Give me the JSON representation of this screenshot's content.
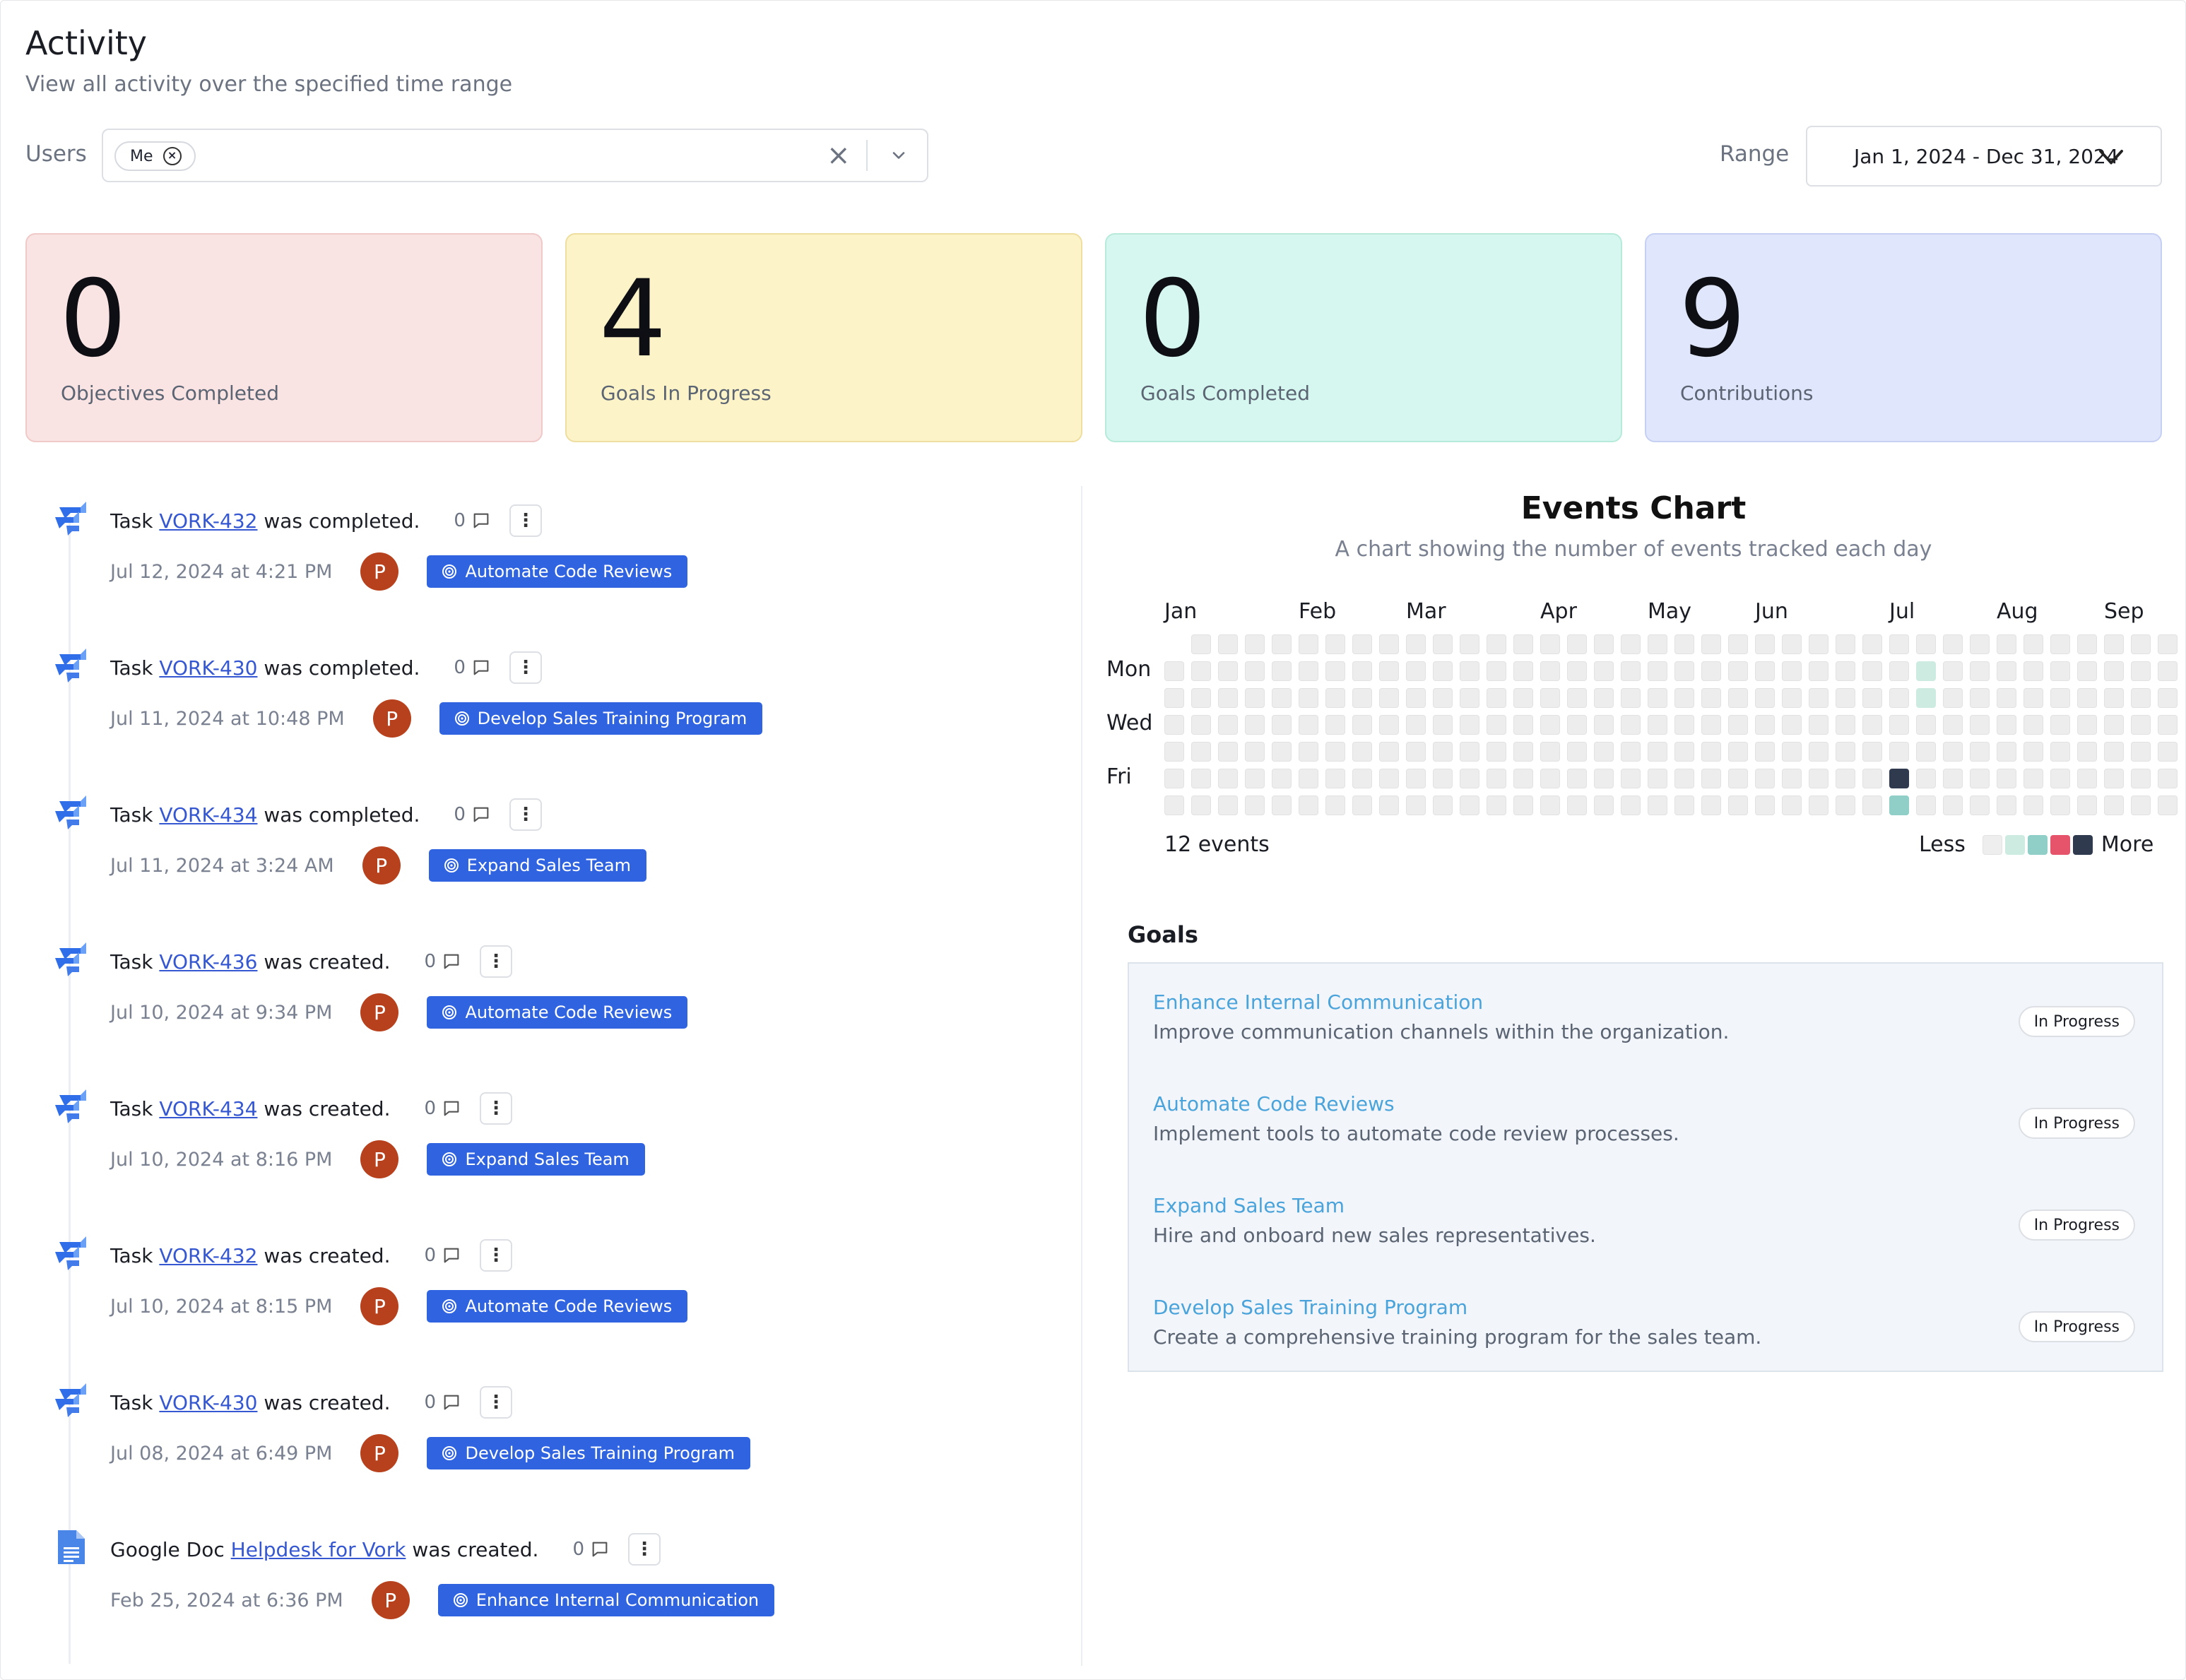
{
  "page": {
    "title": "Activity",
    "subtitle": "View all activity over the specified time range"
  },
  "filters": {
    "users_label": "Users",
    "users_chip": "Me",
    "range_label": "Range",
    "range_value": "Jan 1, 2024 - Dec 31, 2024"
  },
  "stats": [
    {
      "value": "0",
      "label": "Objectives Completed",
      "bg": "#fae3e3",
      "border": "#f0c9c9"
    },
    {
      "value": "4",
      "label": "Goals In Progress",
      "bg": "#fdf3c8",
      "border": "#eedea0"
    },
    {
      "value": "0",
      "label": "Goals Completed",
      "bg": "#d6f7ef",
      "border": "#b7ead9"
    },
    {
      "value": "9",
      "label": "Contributions",
      "bg": "#e0e6fb",
      "border": "#c6d0f3"
    }
  ],
  "activities": [
    {
      "type": "jira",
      "prefix": "Task",
      "link": "VORK-432",
      "suffix": "was completed.",
      "comments": "0",
      "date": "Jul 12, 2024 at 4:21 PM",
      "avatar": "P",
      "goal": "Automate Code Reviews"
    },
    {
      "type": "jira",
      "prefix": "Task",
      "link": "VORK-430",
      "suffix": "was completed.",
      "comments": "0",
      "date": "Jul 11, 2024 at 10:48 PM",
      "avatar": "P",
      "goal": "Develop Sales Training Program"
    },
    {
      "type": "jira",
      "prefix": "Task",
      "link": "VORK-434",
      "suffix": "was completed.",
      "comments": "0",
      "date": "Jul 11, 2024 at 3:24 AM",
      "avatar": "P",
      "goal": "Expand Sales Team"
    },
    {
      "type": "jira",
      "prefix": "Task",
      "link": "VORK-436",
      "suffix": "was created.",
      "comments": "0",
      "date": "Jul 10, 2024 at 9:34 PM",
      "avatar": "P",
      "goal": "Automate Code Reviews"
    },
    {
      "type": "jira",
      "prefix": "Task",
      "link": "VORK-434",
      "suffix": "was created.",
      "comments": "0",
      "date": "Jul 10, 2024 at 8:16 PM",
      "avatar": "P",
      "goal": "Expand Sales Team"
    },
    {
      "type": "jira",
      "prefix": "Task",
      "link": "VORK-432",
      "suffix": "was created.",
      "comments": "0",
      "date": "Jul 10, 2024 at 8:15 PM",
      "avatar": "P",
      "goal": "Automate Code Reviews"
    },
    {
      "type": "jira",
      "prefix": "Task",
      "link": "VORK-430",
      "suffix": "was created.",
      "comments": "0",
      "date": "Jul 08, 2024 at 6:49 PM",
      "avatar": "P",
      "goal": "Develop Sales Training Program"
    },
    {
      "type": "gdoc",
      "prefix": "Google Doc",
      "link": "Helpdesk for Vork",
      "suffix": "was created.",
      "comments": "0",
      "date": "Feb 25, 2024 at 6:36 PM",
      "avatar": "P",
      "goal": "Enhance Internal Communication"
    }
  ],
  "events_chart": {
    "title": "Events Chart",
    "subtitle": "A chart showing the number of events tracked each day",
    "months": [
      "Jan",
      "Feb",
      "Mar",
      "Apr",
      "May",
      "Jun",
      "Jul",
      "Aug",
      "Sep"
    ],
    "day_labels": [
      "Mon",
      "Wed",
      "Fri"
    ],
    "events_count": "12 events",
    "legend_less": "Less",
    "legend_more": "More",
    "scale_colors": [
      "#eeeeee",
      "#cdebe0",
      "#8fcfc8",
      "#e5546b",
      "#2f3a4f"
    ]
  },
  "chart_data": {
    "type": "heatmap",
    "title": "Events Chart",
    "subtitle": "A chart showing the number of events tracked each day",
    "x_tick_labels": [
      "Jan",
      "Feb",
      "Mar",
      "Apr",
      "May",
      "Jun",
      "Jul",
      "Aug",
      "Sep"
    ],
    "y_tick_labels": [
      "Mon",
      "Wed",
      "Fri"
    ],
    "rows": [
      "Sun",
      "Mon",
      "Tue",
      "Wed",
      "Thu",
      "Fri",
      "Sat"
    ],
    "total": "12 events",
    "visible_weeks": 38,
    "nonzero_cells": [
      {
        "week": 28,
        "weekday": 1,
        "level": 1
      },
      {
        "week": 28,
        "weekday": 2,
        "level": 1
      },
      {
        "week": 27,
        "weekday": 5,
        "level": 4
      },
      {
        "week": 27,
        "weekday": 6,
        "level": 2
      }
    ]
  },
  "goals": {
    "title": "Goals",
    "items": [
      {
        "name": "Enhance Internal Communication",
        "desc": "Improve communication channels within the organization.",
        "status": "In Progress"
      },
      {
        "name": "Automate Code Reviews",
        "desc": "Implement tools to automate code review processes.",
        "status": "In Progress"
      },
      {
        "name": "Expand Sales Team",
        "desc": "Hire and onboard new sales representatives.",
        "status": "In Progress"
      },
      {
        "name": "Develop Sales Training Program",
        "desc": "Create a comprehensive training program for the sales team.",
        "status": "In Progress"
      }
    ]
  }
}
